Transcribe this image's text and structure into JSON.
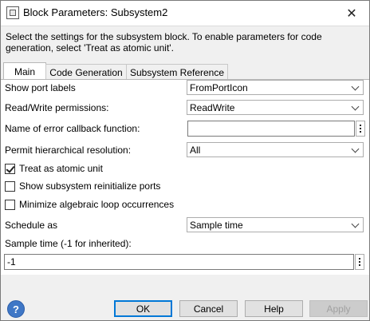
{
  "window": {
    "title": "Block Parameters: Subsystem2",
    "close_glyph": "✕"
  },
  "description": "Select the settings for the subsystem block. To enable parameters for code generation, select 'Treat as atomic unit'.",
  "tabs": [
    {
      "label": "Main",
      "active": true
    },
    {
      "label": "Code Generation",
      "active": false
    },
    {
      "label": "Subsystem Reference",
      "active": false
    }
  ],
  "form": {
    "show_port_labels": {
      "label": "Show port labels",
      "value": "FromPortIcon"
    },
    "read_write": {
      "label": "Read/Write permissions:",
      "value": "ReadWrite"
    },
    "error_callback": {
      "label": "Name of error callback function:",
      "value": ""
    },
    "hier_resolution": {
      "label": "Permit hierarchical resolution:",
      "value": "All"
    },
    "treat_atomic": {
      "label": "Treat as atomic unit",
      "checked": true
    },
    "show_reinit": {
      "label": "Show subsystem reinitialize ports",
      "checked": false
    },
    "minimize_loops": {
      "label": "Minimize algebraic loop occurrences",
      "checked": false
    },
    "schedule_as": {
      "label": "Schedule as",
      "value": "Sample time"
    },
    "sample_time": {
      "label": "Sample time (-1 for inherited):",
      "value": "-1"
    }
  },
  "buttons": {
    "help_glyph": "?",
    "ok": "OK",
    "cancel": "Cancel",
    "help": "Help",
    "apply": "Apply"
  },
  "icons": {
    "app": "block-parameters-icon",
    "close": "close-icon",
    "help": "help-icon",
    "dropdown": "chevron-down-icon",
    "more": "kebab-menu-icon"
  }
}
